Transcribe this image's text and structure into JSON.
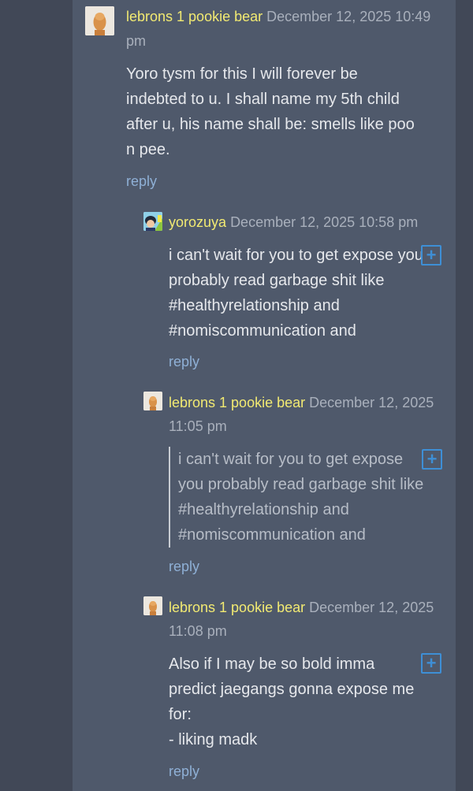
{
  "comments": [
    {
      "author": "lebrons 1 pookie bear",
      "date": "December 12, 2025 10:49",
      "date_cont": "pm",
      "lines": [
        "Yoro tysm for this I will forever be",
        "indebted to u. I shall name my 5th child",
        "after u, his name shall be: smells like poo",
        "n pee."
      ],
      "reply": "reply",
      "avatar_icon": "lebron-photo-avatar"
    },
    {
      "author": "yorozuya",
      "date": "December 12, 2025 10:58 pm",
      "lines": [
        "i can't wait for you to get expose you",
        "probably read garbage shit like",
        "#healthyrelationship and",
        "#nomiscommunication and"
      ],
      "reply": "reply",
      "expand": "+",
      "avatar_icon": "anime-avatar"
    },
    {
      "author": "lebrons 1 pookie bear",
      "date": "December 12, 2025",
      "date_cont": "11:05 pm",
      "quote_lines": [
        "i can't wait for you to get expose",
        "you probably read garbage shit like",
        "#healthyrelationship and",
        "#nomiscommunication and"
      ],
      "reply": "reply",
      "expand": "+",
      "avatar_icon": "lebron-photo-avatar"
    },
    {
      "author": "lebrons 1 pookie bear",
      "date": "December 12, 2025",
      "date_cont": "11:08 pm",
      "lines": [
        "Also if I may be so bold imma",
        "predict jaegangs gonna expose me",
        "for:",
        "- liking madk"
      ],
      "reply": "reply",
      "expand": "+",
      "avatar_icon": "lebron-photo-avatar"
    }
  ],
  "colors": {
    "background": "#414857",
    "panel": "#4f596b",
    "author": "#f2ea72",
    "link": "#8fb0d6",
    "accent": "#3e8fd6"
  }
}
